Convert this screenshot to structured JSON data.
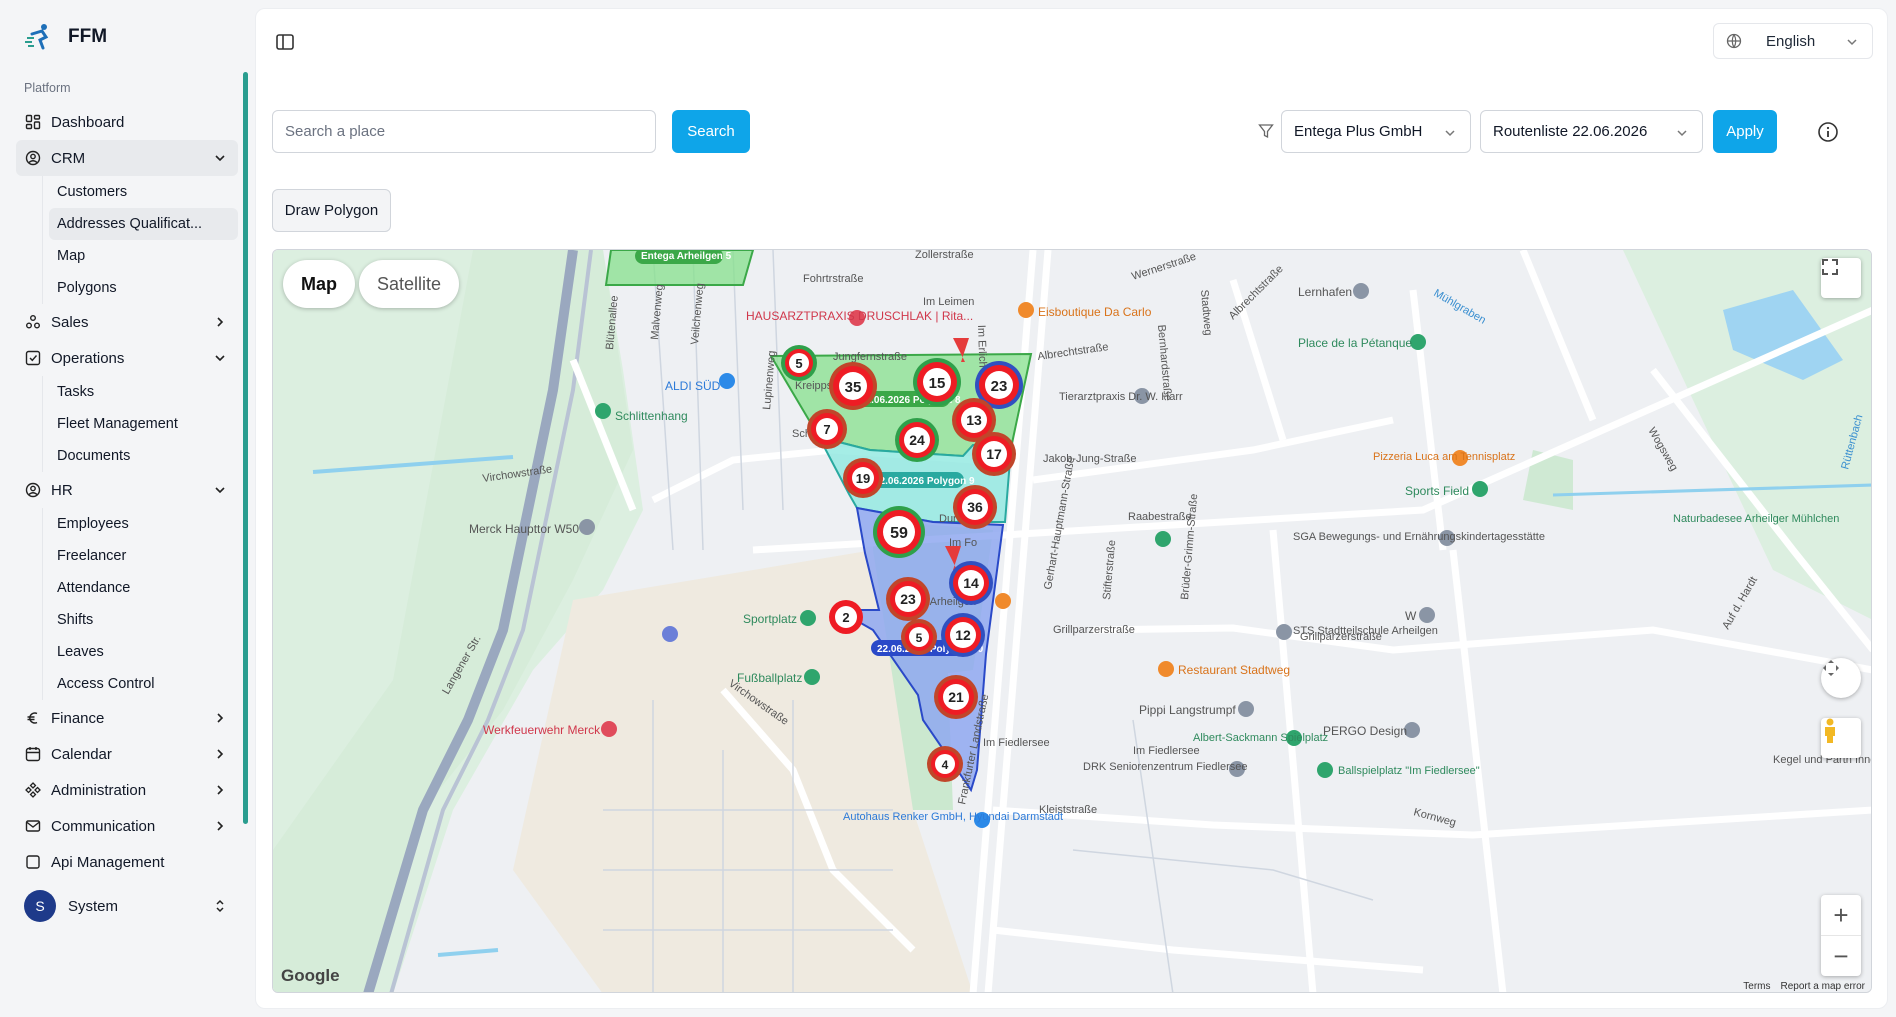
{
  "brand": {
    "name": "FFM"
  },
  "sidebar": {
    "section_label": "Platform",
    "items": [
      {
        "label": "Dashboard"
      },
      {
        "label": "CRM",
        "children": [
          "Customers",
          "Addresses Qualificat...",
          "Map",
          "Polygons"
        ]
      },
      {
        "label": "Sales"
      },
      {
        "label": "Operations",
        "children": [
          "Tasks",
          "Fleet Management",
          "Documents"
        ]
      },
      {
        "label": "HR",
        "children": [
          "Employees",
          "Freelancer",
          "Attendance",
          "Shifts",
          "Leaves",
          "Access Control"
        ]
      },
      {
        "label": "Finance"
      },
      {
        "label": "Calendar"
      },
      {
        "label": "Administration"
      },
      {
        "label": "Communication"
      },
      {
        "label": "Api Management"
      }
    ]
  },
  "user": {
    "initial": "S",
    "name": "System"
  },
  "header": {
    "language": "English"
  },
  "search": {
    "placeholder": "Search a place",
    "button": "Search"
  },
  "filters": {
    "company": "Entega Plus GmbH",
    "route": "Routenliste 22.06.2026",
    "apply": "Apply"
  },
  "draw_button": "Draw Polygon",
  "map": {
    "type_map": "Map",
    "type_satellite": "Satellite",
    "polygon_labels": [
      "Entega Arheilgen 5",
      "22.06.2026 Polygon 8",
      "22.06.2026 Polygon 9",
      "22.06.2026 Polygon 10"
    ],
    "clusters": [
      "5",
      "35",
      "15",
      "23",
      "13",
      "7",
      "24",
      "17",
      "19",
      "36",
      "59",
      "14",
      "23",
      "2",
      "5",
      "12",
      "21",
      "4"
    ],
    "streets": [
      "Zollerstraße",
      "Fohrtrstraße",
      "Blütenallee",
      "Malvenweg",
      "Veilchenweg",
      "Im Leimen",
      "Im Erlich",
      "Jungfernstraße",
      "Albrechtstraße",
      "Werner­straße",
      "Bernhardstraße",
      "Stadtweg",
      "Albrechtstraße",
      "Jakob-Jung-Straße",
      "Raabestraße",
      "Gerhart-Hauptmann-Straße",
      "Stifterstraße",
      "Brüder-Grimm-Straße",
      "Grillparzerstraße",
      "Grillparzerstraße",
      "Virchowstraße",
      "Virchowstraße",
      "Langener Str.",
      "Frankfurter Landstraße",
      "Im Fiedlersee",
      "Im Fiedlersee",
      "Kleiststraße",
      "Korn­weg",
      "Mühlgraben",
      "Wogsweg",
      "Auf d. Hardt",
      "Lupinenweg",
      "Rüttenbach"
    ],
    "places": [
      "HAUSARZTPRAXIS DRUSCHLAK | Rita...",
      "ALDI SÜD",
      "Schlittenhang",
      "Eisboutique Da Carlo",
      "Lernhafen",
      "Place de la Pétanque",
      "Tierarztpraxis Dr. W. Harr",
      "Pizzeria Luca am Tennisplatz",
      "Sports Field",
      "Naturbadesee Arheilger Mühlchen",
      "SGA Bewegungs- und Ernährungskindertagesstätte",
      "Merck Haupttor W50",
      "STS Stadtteilschule Arheilgen",
      "Restaurant Stadtweg",
      "Pippi Langstrumpf",
      "Albert-Sackmann Spielplatz",
      "PERGO Design",
      "Ballspielplatz \"Im Fiedlersee\"",
      "DRK Seniorenzentrum Fiedlersee",
      "Sportplatz",
      "Fußballplatz",
      "Werkfeuerwehr Merck",
      "Autohaus Renker GmbH, Hyundai Darmstadt",
      "Kegel und Partn Innenarchitekt",
      "W",
      "Kreipps",
      "Sch",
      "Durer",
      "Im Fo",
      "ho Arheilgen"
    ],
    "google": "Google",
    "terms": "Terms",
    "report": "Report a map error"
  },
  "colors": {
    "accent": "#0ea5e9",
    "green_poly": "#86e08c",
    "cyan_poly": "#8ee8e0",
    "blue_poly": "#8fa8f0",
    "cluster_red": "#ee1c24"
  }
}
